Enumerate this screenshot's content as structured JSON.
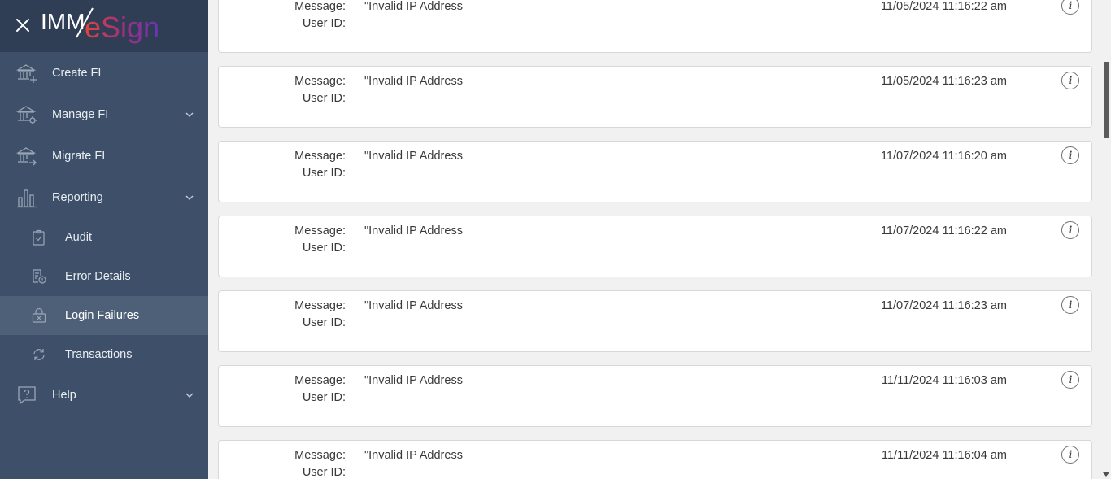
{
  "app": {
    "logo_text": "IMM eSign",
    "brand_colors": {
      "dark": "#2f3e55",
      "sidebar": "#3e5069",
      "accent_gradient": [
        "#e2453c",
        "#a1307d",
        "#6a34b8"
      ]
    }
  },
  "sidebar": {
    "close_icon": "close-icon",
    "items": [
      {
        "label": "Create FI",
        "icon": "bank-plus-icon"
      },
      {
        "label": "Manage FI",
        "icon": "bank-gear-icon",
        "expandable": true
      },
      {
        "label": "Migrate FI",
        "icon": "bank-arrow-icon"
      },
      {
        "label": "Reporting",
        "icon": "bar-chart-icon",
        "expandable": true,
        "expanded": true,
        "children": [
          {
            "label": "Audit",
            "icon": "clipboard-check-icon"
          },
          {
            "label": "Error Details",
            "icon": "document-error-icon"
          },
          {
            "label": "Login Failures",
            "icon": "lock-x-icon",
            "active": true
          },
          {
            "label": "Transactions",
            "icon": "sync-icon"
          }
        ]
      },
      {
        "label": "Help",
        "icon": "help-bubble-icon",
        "expandable": true
      }
    ]
  },
  "records": [
    {
      "message_label": "Message:",
      "user_label": "User ID:",
      "message": "\"Invalid IP Address",
      "timestamp": "11/05/2024 11:16:22 am"
    },
    {
      "message_label": "Message:",
      "user_label": "User ID:",
      "message": "\"Invalid IP Address",
      "timestamp": "11/05/2024 11:16:23 am"
    },
    {
      "message_label": "Message:",
      "user_label": "User ID:",
      "message": "\"Invalid IP Address",
      "timestamp": "11/07/2024 11:16:20 am"
    },
    {
      "message_label": "Message:",
      "user_label": "User ID:",
      "message": "\"Invalid IP Address",
      "timestamp": "11/07/2024 11:16:22 am"
    },
    {
      "message_label": "Message:",
      "user_label": "User ID:",
      "message": "\"Invalid IP Address",
      "timestamp": "11/07/2024 11:16:23 am"
    },
    {
      "message_label": "Message:",
      "user_label": "User ID:",
      "message": "\"Invalid IP Address",
      "timestamp": "11/11/2024 11:16:03 am"
    },
    {
      "message_label": "Message:",
      "user_label": "User ID:",
      "message": "\"Invalid IP Address",
      "timestamp": "11/11/2024 11:16:04 am"
    }
  ],
  "info_icon_glyph": "i"
}
